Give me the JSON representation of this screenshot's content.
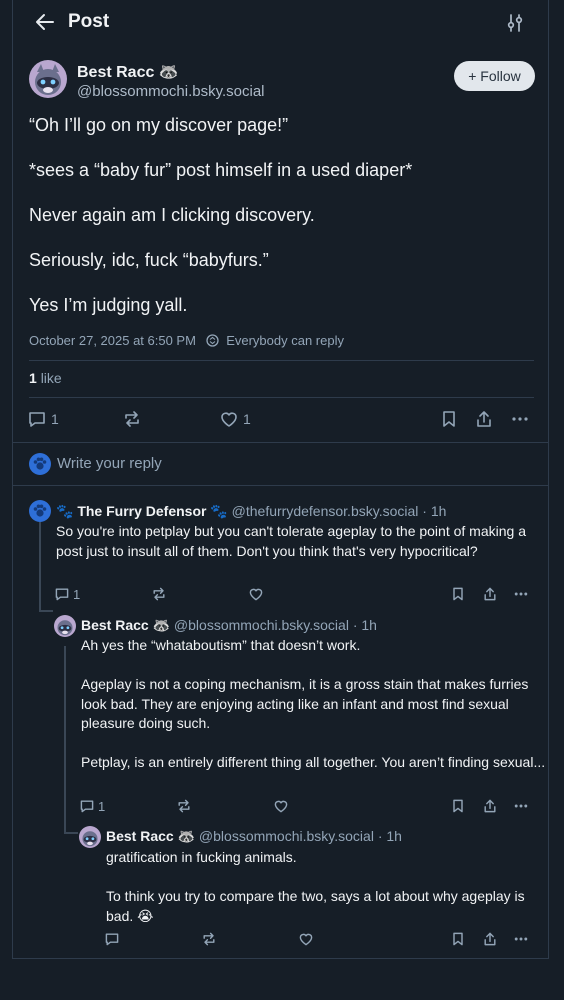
{
  "header": {
    "title": "Post",
    "back_icon": "arrow-left-icon",
    "settings_icon": "sliders-icon"
  },
  "post": {
    "author": "Best Racc 🦝",
    "handle": "@blossommochi.bsky.social",
    "follow_label": "+ Follow",
    "text": [
      "“Oh I’ll go on my discover page!”",
      "*sees a “baby fur” post himself in a used diaper*",
      "Never again am I clicking discovery.",
      "Seriously, idc, fuck “babyfurs.”",
      "Yes I’m judging yall."
    ],
    "timestamp": "October 27, 2025 at 6:50 PM",
    "reply_setting": "Everybody can reply",
    "likes_count": "1",
    "likes_label": "like",
    "reply_count": "1",
    "like_count": "1"
  },
  "reply_box": {
    "placeholder": "Write your reply"
  },
  "replies": [
    {
      "author": "🐾 The Furry Defensor 🐾",
      "handle": "@thefurrydefensor.bsky.social",
      "time": "· 1h",
      "text": [
        "So you're into petplay but you can't tolerate ageplay to the point of making a post just to insult all of them. Don't you think that's very hypocritical?"
      ],
      "reply_count": "1"
    },
    {
      "author": "Best Racc 🦝",
      "handle": "@blossommochi.bsky.social",
      "time": "· 1h",
      "text": [
        "Ah yes the “whataboutism” that doesn’t work.",
        "Ageplay is not a coping mechanism, it is a gross stain that makes furries look bad. They are enjoying acting like an infant and most find sexual pleasure doing such.",
        "Petplay, is an entirely different thing all together. You aren’t finding sexual..."
      ],
      "reply_count": "1"
    },
    {
      "author": "Best Racc 🦝",
      "handle": "@blossommochi.bsky.social",
      "time": "· 1h",
      "text": [
        "gratification in fucking animals.",
        "To think you try to compare the two, says a lot about why ageplay is bad. 😭"
      ],
      "reply_count": ""
    }
  ],
  "colors": {
    "background": "#161e27",
    "border": "#2e3b4b",
    "muted": "#93a5b7",
    "follow_bg": "#e2e7ec"
  }
}
